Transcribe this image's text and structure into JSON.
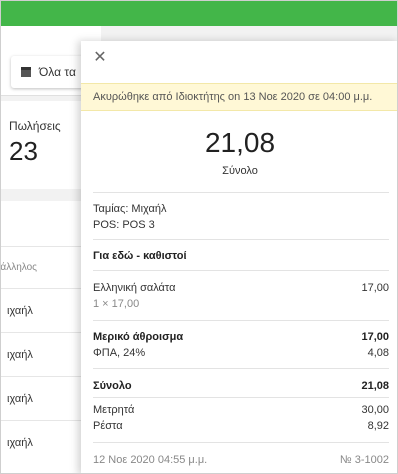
{
  "background": {
    "filter_button": {
      "label": "Όλα τα"
    },
    "sales_card": {
      "label": "Πωλήσεις",
      "value": "23"
    },
    "list": {
      "header": "Υπάλληλος",
      "rows": [
        "ιχαήλ",
        "ιχαήλ",
        "ιχαήλ",
        "ιχαήλ"
      ]
    }
  },
  "receipt": {
    "close_icon": "close-icon",
    "cancel_notice": "Ακυρώθηκε από Ιδιοκτήτης on 13 Νοε 2020 σε 04:00 μ.μ.",
    "total_amount": "21,08",
    "total_label": "Σύνολο",
    "cashier": "Ταμίας: Μιχαήλ",
    "pos": "POS: POS 3",
    "dining_option": "Για εδώ - καθιστοί",
    "items": [
      {
        "name": "Ελληνική σαλάτα",
        "qty_price": "1 × 17,00",
        "amount": "17,00"
      }
    ],
    "subtotal_label": "Μερικό άθροισμα",
    "subtotal_value": "17,00",
    "tax_label": "ΦΠΑ, 24%",
    "tax_value": "4,08",
    "grand_total_label": "Σύνολο",
    "grand_total_value": "21,08",
    "cash_label": "Μετρητά",
    "cash_value": "30,00",
    "change_label": "Ρέστα",
    "change_value": "8,92",
    "datetime": "12 Νοε 2020 04:55 μ.μ.",
    "receipt_number": "№ 3-1002"
  },
  "colors": {
    "topbar": "#43b649",
    "banner": "#fff8d6"
  }
}
